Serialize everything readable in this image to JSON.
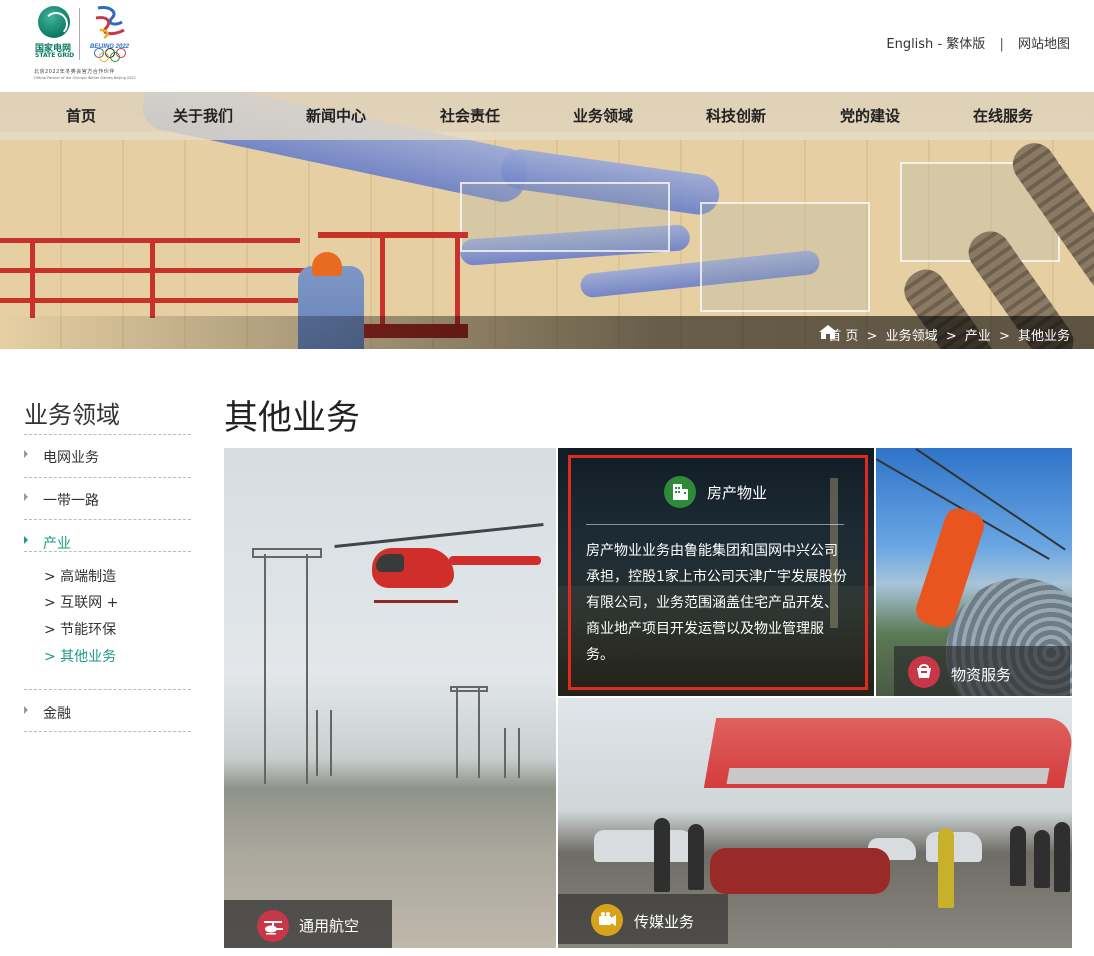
{
  "header": {
    "logo": {
      "state_grid_cn": "国家电网",
      "state_grid_en": "STATE GRID",
      "olympic_text": "BEIJING 2022",
      "partner_cn": "北京2022年冬奥会官方合作伙伴",
      "partner_en": "Official Partner of the Olympic Winter Games Beijing 2022"
    },
    "links": {
      "english": "English",
      "dash": "-",
      "traditional": "繁体版",
      "separator": "|",
      "sitemap": "网站地图"
    }
  },
  "nav": {
    "items": [
      "首页",
      "关于我们",
      "新闻中心",
      "社会责任",
      "业务领域",
      "科技创新",
      "党的建设",
      "在线服务"
    ]
  },
  "breadcrumb": {
    "items": [
      "首 页",
      "业务领域",
      "产业",
      "其他业务"
    ],
    "separator": ">"
  },
  "sidebar": {
    "title": "业务领域",
    "items": [
      "电网业务",
      "一带一路",
      "产业",
      "金融"
    ],
    "active_item": "产业",
    "sub_items": [
      "> 高端制造",
      "> 互联网 +",
      "> 节能环保",
      "> 其他业务"
    ],
    "active_sub_item": "> 其他业务"
  },
  "main": {
    "title": "其他业务",
    "tiles": {
      "aviation": {
        "label": "通用航空",
        "icon": "helicopter-icon",
        "icon_color": "#c8364a"
      },
      "property": {
        "label": "房产物业",
        "icon": "building-icon",
        "icon_color": "#2e8b3a",
        "description": "房产物业业务由鲁能集团和国网中兴公司承担，控股1家上市公司天津广宇发展股份有限公司，业务范围涵盖住宅产品开发、商业地产项目开发运营以及物业管理服务。"
      },
      "material": {
        "label": "物资服务",
        "icon": "basket-icon",
        "icon_color": "#c8364a"
      },
      "media": {
        "label": "传媒业务",
        "icon": "camera-icon",
        "icon_color": "#d9a21b"
      }
    }
  },
  "colors": {
    "accent": "#1a9a8a",
    "highlight_border": "#e02a20",
    "nav_bar": "#e6dcc8"
  }
}
